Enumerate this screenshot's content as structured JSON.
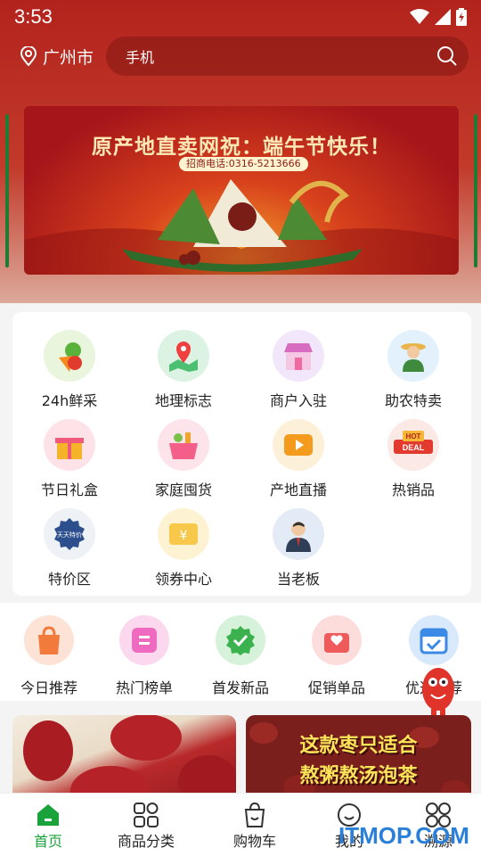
{
  "status_bar": {
    "time": "3:53"
  },
  "header": {
    "location": "广州市",
    "search_text": "手机"
  },
  "banner": {
    "title": "原产地直卖网祝：端午节快乐！",
    "phone": "招商电话:0316-5213666"
  },
  "grid": [
    {
      "label": "24h鲜采",
      "icon": "vegetables-icon"
    },
    {
      "label": "地理标志",
      "icon": "map-pin-icon"
    },
    {
      "label": "商户入驻",
      "icon": "storefront-icon"
    },
    {
      "label": "助农特卖",
      "icon": "farmer-icon"
    },
    {
      "label": "节日礼盒",
      "icon": "gift-box-icon"
    },
    {
      "label": "家庭囤货",
      "icon": "shopping-basket-icon"
    },
    {
      "label": "产地直播",
      "icon": "live-play-icon"
    },
    {
      "label": "热销品",
      "icon": "hot-deal-icon"
    },
    {
      "label": "特价区",
      "icon": "special-price-icon",
      "badge": "天天特价"
    },
    {
      "label": "领券中心",
      "icon": "coupon-icon"
    },
    {
      "label": "当老板",
      "icon": "boss-avatar-icon"
    }
  ],
  "hot_deal_badge": {
    "top": "HOT",
    "bottom": "DEAL"
  },
  "quick_row": [
    {
      "label": "今日推荐",
      "icon": "shopping-bag-icon"
    },
    {
      "label": "热门榜单",
      "icon": "list-icon"
    },
    {
      "label": "首发新品",
      "icon": "badge-check-icon"
    },
    {
      "label": "促销单品",
      "icon": "heart-cart-icon"
    },
    {
      "label": "优选推荐",
      "icon": "calendar-check-icon"
    }
  ],
  "products": [
    {
      "name": "red-dates-product"
    },
    {
      "name": "red-dates-soup-product",
      "caption_line1": "这款枣只适合",
      "caption_line2": "熬粥熬汤泡茶"
    }
  ],
  "tabbar": [
    {
      "label": "首页",
      "icon": "home-icon",
      "active": true
    },
    {
      "label": "商品分类",
      "icon": "category-grid-icon"
    },
    {
      "label": "购物车",
      "icon": "cart-bag-icon"
    },
    {
      "label": "我的",
      "icon": "profile-smile-icon"
    },
    {
      "label": "溯源",
      "icon": "trace-grid-icon"
    }
  ],
  "watermark": "ITMOP.COM",
  "colors": {
    "accent": "#1aa33a",
    "hero_red": "#b3231d"
  }
}
